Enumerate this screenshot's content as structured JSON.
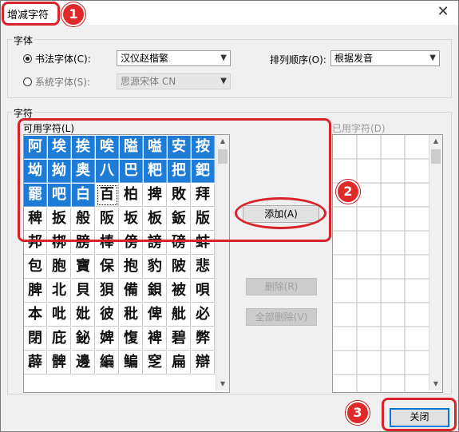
{
  "window": {
    "title": "增减字符",
    "close_glyph": "✕"
  },
  "font_group": {
    "label": "字体",
    "calligraphy_radio": "书法字体(C):",
    "calligraphy_font": "汉仪赵楷繁",
    "system_radio": "系统字体(S):",
    "system_font": "思源宋体 CN",
    "sort_label": "排列顺序(O):",
    "sort_value": "根据发音"
  },
  "chars_group": {
    "label": "字符",
    "available_label": "可用字符(L)",
    "used_label": "已用字符(D)",
    "available_chars": [
      [
        "阿",
        "埃",
        "挨",
        "唉",
        "隘",
        "嗌",
        "安",
        "按"
      ],
      [
        "坳",
        "拗",
        "奥",
        "八",
        "巴",
        "粑",
        "把",
        "鈀"
      ],
      [
        "罷",
        "吧",
        "白",
        "百",
        "柏",
        "捭",
        "敗",
        "拜"
      ],
      [
        "稗",
        "扳",
        "般",
        "阪",
        "坂",
        "板",
        "鈑",
        "版"
      ],
      [
        "邦",
        "梆",
        "膀",
        "棒",
        "傍",
        "謗",
        "磅",
        "蚌"
      ],
      [
        "包",
        "胞",
        "寶",
        "保",
        "抱",
        "豹",
        "陂",
        "悲"
      ],
      [
        "脾",
        "北",
        "貝",
        "狽",
        "備",
        "鋇",
        "被",
        "唄"
      ],
      [
        "本",
        "吡",
        "妣",
        "彼",
        "秕",
        "俾",
        "舭",
        "必"
      ],
      [
        "閉",
        "庇",
        "鉍",
        "婢",
        "愎",
        "裨",
        "碧",
        "弊"
      ],
      [
        "薜",
        "髀",
        "邊",
        "編",
        "鳊",
        "窆",
        "扁",
        "辯"
      ]
    ],
    "add_button": "添加(A)",
    "delete_button": "删除(R)",
    "delete_all_button": "全部删除(V)"
  },
  "close_button": "关闭",
  "annotations": {
    "badge1": "1",
    "badge2": "2",
    "badge3": "3"
  },
  "colors": {
    "selection": "#1e7bd6",
    "highlight": "#d9232a"
  }
}
